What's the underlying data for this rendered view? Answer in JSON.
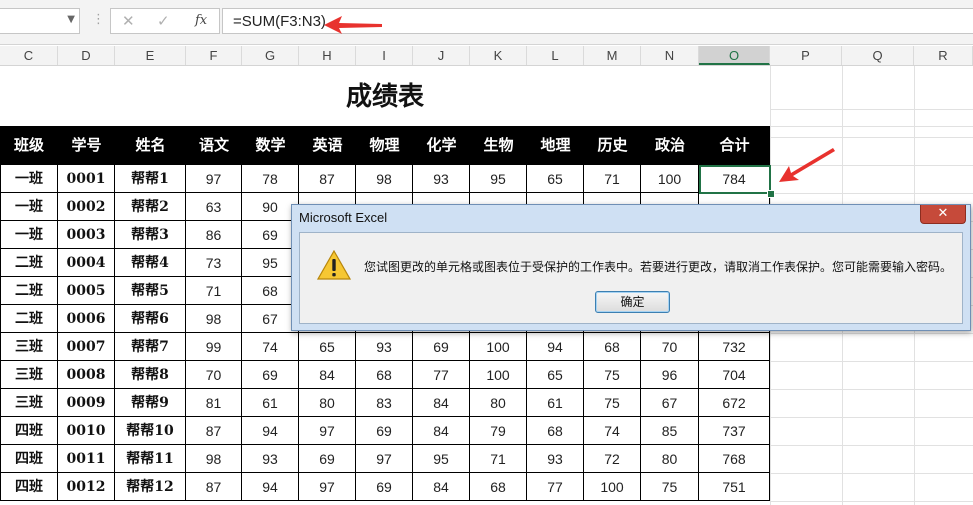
{
  "formula_bar": {
    "name_box": "",
    "cancel_glyph": "✕",
    "enter_glyph": "✓",
    "fx_label": "fx",
    "formula": "=SUM(F3:N3)"
  },
  "columns": [
    "C",
    "D",
    "E",
    "F",
    "G",
    "H",
    "I",
    "J",
    "K",
    "L",
    "M",
    "N",
    "O",
    "P",
    "Q",
    "R"
  ],
  "selected_column": "O",
  "sheet": {
    "title": "成绩表",
    "headers": [
      "班级",
      "学号",
      "姓名",
      "语文",
      "数学",
      "英语",
      "物理",
      "化学",
      "生物",
      "地理",
      "历史",
      "政治",
      "合计"
    ],
    "rows": [
      [
        "一班",
        "0001",
        "帮帮1",
        "97",
        "78",
        "87",
        "98",
        "93",
        "95",
        "65",
        "71",
        "100",
        "784"
      ],
      [
        "一班",
        "0002",
        "帮帮2",
        "63",
        "90",
        "",
        "",
        "",
        "",
        "",
        "",
        "",
        ""
      ],
      [
        "一班",
        "0003",
        "帮帮3",
        "86",
        "69",
        "",
        "",
        "",
        "",
        "",
        "",
        "",
        ""
      ],
      [
        "二班",
        "0004",
        "帮帮4",
        "73",
        "95",
        "",
        "",
        "",
        "",
        "",
        "",
        "",
        ""
      ],
      [
        "二班",
        "0005",
        "帮帮5",
        "71",
        "68",
        "",
        "",
        "",
        "",
        "",
        "",
        "",
        ""
      ],
      [
        "二班",
        "0006",
        "帮帮6",
        "98",
        "67",
        "",
        "",
        "",
        "",
        "",
        "",
        "",
        ""
      ],
      [
        "三班",
        "0007",
        "帮帮7",
        "99",
        "74",
        "65",
        "93",
        "69",
        "100",
        "94",
        "68",
        "70",
        "732"
      ],
      [
        "三班",
        "0008",
        "帮帮8",
        "70",
        "69",
        "84",
        "68",
        "77",
        "100",
        "65",
        "75",
        "96",
        "704"
      ],
      [
        "三班",
        "0009",
        "帮帮9",
        "81",
        "61",
        "80",
        "83",
        "84",
        "80",
        "61",
        "75",
        "67",
        "672"
      ],
      [
        "四班",
        "0010",
        "帮帮10",
        "87",
        "94",
        "97",
        "69",
        "84",
        "79",
        "68",
        "74",
        "85",
        "737"
      ],
      [
        "四班",
        "0011",
        "帮帮11",
        "98",
        "93",
        "69",
        "97",
        "95",
        "71",
        "93",
        "72",
        "80",
        "768"
      ],
      [
        "四班",
        "0012",
        "帮帮12",
        "87",
        "94",
        "97",
        "69",
        "84",
        "68",
        "77",
        "100",
        "75",
        "751"
      ]
    ]
  },
  "dialog": {
    "title": "Microsoft Excel",
    "close_glyph": "✕",
    "message": "您试图更改的单元格或图表位于受保护的工作表中。若要进行更改，请取消工作表保护。您可能需要输入密码。",
    "ok_label": "确定"
  },
  "colors": {
    "accent_green": "#217346",
    "header_bg": "#000000",
    "arrow_red": "#e8322e"
  }
}
